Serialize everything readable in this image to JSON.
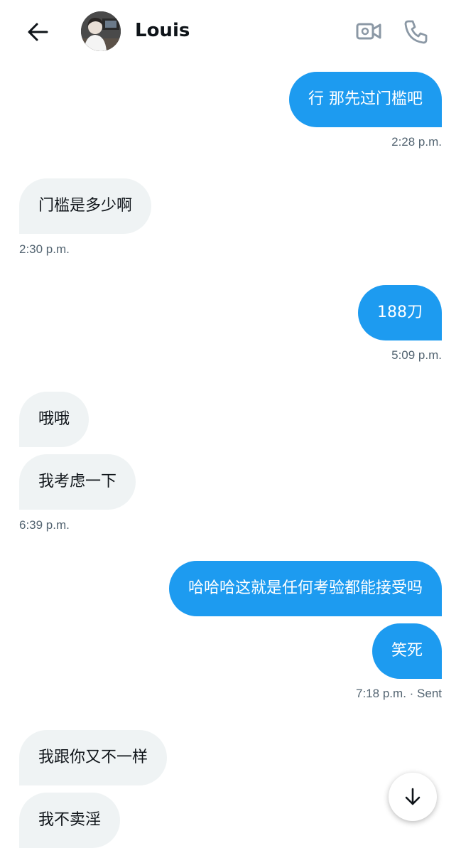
{
  "header": {
    "contact_name": "Louis",
    "back_icon": "arrow-left-icon",
    "video_icon": "video-camera-icon",
    "call_icon": "phone-icon"
  },
  "colors": {
    "outgoing": "#1d9bf0",
    "incoming": "#eff3f4",
    "timestamp": "#536471"
  },
  "messages": [
    {
      "direction": "out",
      "text": "行 那先过门槛吧"
    },
    {
      "direction": "in",
      "text": "门槛是多少啊"
    },
    {
      "direction": "out",
      "text": "188刀"
    },
    {
      "direction": "in",
      "text": "哦哦"
    },
    {
      "direction": "in",
      "text": "我考虑一下"
    },
    {
      "direction": "out",
      "text": "哈哈哈这就是任何考验都能接受吗"
    },
    {
      "direction": "out",
      "text": "笑死"
    },
    {
      "direction": "in",
      "text": "我跟你又不一样"
    },
    {
      "direction": "in",
      "text": "我不卖淫"
    }
  ],
  "timestamps": [
    "2:28 p.m.",
    "2:30 p.m.",
    "5:09 p.m.",
    "6:39 p.m.",
    "7:18 p.m. · Sent"
  ],
  "scroll_button": {
    "icon": "arrow-down-icon"
  }
}
